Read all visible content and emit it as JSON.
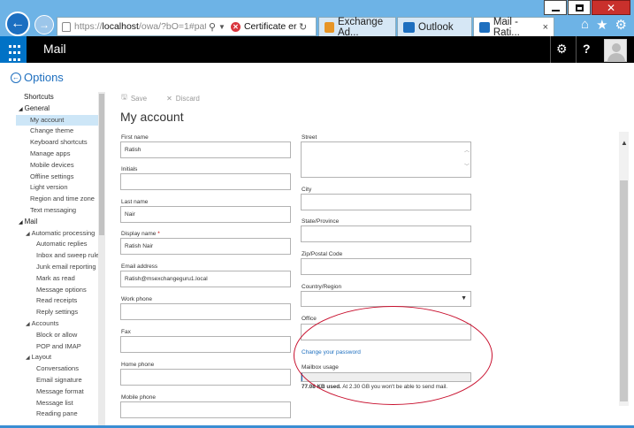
{
  "browser": {
    "address": {
      "prefix": "https://",
      "host": "localhost",
      "path": "/owa/?bO=1#pat",
      "search_icon": "search-icon",
      "cert_text": "Certificate er..."
    },
    "tabs": [
      {
        "label": "Exchange Ad...",
        "icon": "exchange-admin-icon"
      },
      {
        "label": "Outlook",
        "icon": "outlook-icon"
      },
      {
        "label": "Mail - Rati...",
        "icon": "mail-icon",
        "active": true
      }
    ],
    "close_glyph": "×",
    "right_icons": [
      "home-icon",
      "star-icon",
      "settings-icon"
    ]
  },
  "owa": {
    "app_title": "Mail",
    "gear_glyph": "⚙",
    "help_glyph": "?"
  },
  "options": {
    "back_glyph": "←",
    "label": "Options"
  },
  "nav": [
    {
      "label": "Shortcuts",
      "kind": "h"
    },
    {
      "label": "General",
      "kind": "g",
      "tri": "◢"
    },
    {
      "label": "My account",
      "kind": "i1",
      "selected": true
    },
    {
      "label": "Change theme",
      "kind": "i1"
    },
    {
      "label": "Keyboard shortcuts",
      "kind": "i1"
    },
    {
      "label": "Manage apps",
      "kind": "i1"
    },
    {
      "label": "Mobile devices",
      "kind": "i1"
    },
    {
      "label": "Offline settings",
      "kind": "i1"
    },
    {
      "label": "Light version",
      "kind": "i1"
    },
    {
      "label": "Region and time zone",
      "kind": "i1"
    },
    {
      "label": "Text messaging",
      "kind": "i1"
    },
    {
      "label": "Mail",
      "kind": "g",
      "tri": "◢"
    },
    {
      "label": "Automatic processing",
      "kind": "g2",
      "tri": "◢"
    },
    {
      "label": "Automatic replies",
      "kind": "i2"
    },
    {
      "label": "Inbox and sweep rules",
      "kind": "i2"
    },
    {
      "label": "Junk email reporting",
      "kind": "i2"
    },
    {
      "label": "Mark as read",
      "kind": "i2"
    },
    {
      "label": "Message options",
      "kind": "i2"
    },
    {
      "label": "Read receipts",
      "kind": "i2"
    },
    {
      "label": "Reply settings",
      "kind": "i2"
    },
    {
      "label": "Accounts",
      "kind": "g2",
      "tri": "◢"
    },
    {
      "label": "Block or allow",
      "kind": "i2"
    },
    {
      "label": "POP and IMAP",
      "kind": "i2"
    },
    {
      "label": "Layout",
      "kind": "g2",
      "tri": "◢"
    },
    {
      "label": "Conversations",
      "kind": "i2"
    },
    {
      "label": "Email signature",
      "kind": "i2"
    },
    {
      "label": "Message format",
      "kind": "i2"
    },
    {
      "label": "Message list",
      "kind": "i2"
    },
    {
      "label": "Reading pane",
      "kind": "i2"
    }
  ],
  "toolbar": {
    "save_label": "Save",
    "discard_label": "Discard",
    "save_glyph": "🖫",
    "discard_glyph": "✕"
  },
  "page_title": "My account",
  "form": {
    "first_name": {
      "label": "First name",
      "value": "Ratish"
    },
    "initials": {
      "label": "Initials",
      "value": ""
    },
    "last_name": {
      "label": "Last name",
      "value": "Nair"
    },
    "display_name": {
      "label": "Display name",
      "required": "*",
      "value": "Ratish Nair"
    },
    "email": {
      "label": "Email address",
      "value": "Ratish@msexchangeguru1.local"
    },
    "work_phone": {
      "label": "Work phone",
      "value": ""
    },
    "fax": {
      "label": "Fax",
      "value": ""
    },
    "home_phone": {
      "label": "Home phone",
      "value": ""
    },
    "mobile_phone": {
      "label": "Mobile phone",
      "value": ""
    },
    "street": {
      "label": "Street",
      "value": ""
    },
    "city": {
      "label": "City",
      "value": ""
    },
    "state": {
      "label": "State/Province",
      "value": ""
    },
    "zip": {
      "label": "Zip/Postal Code",
      "value": ""
    },
    "country": {
      "label": "Country/Region",
      "value": ""
    },
    "office": {
      "label": "Office",
      "value": ""
    }
  },
  "change_password": "Change your password",
  "mailbox": {
    "label": "Mailbox usage",
    "used": "77.08 KB used.",
    "note": "At 2.30 GB you won't be able to send mail.",
    "fill_fraction": 0.003
  }
}
